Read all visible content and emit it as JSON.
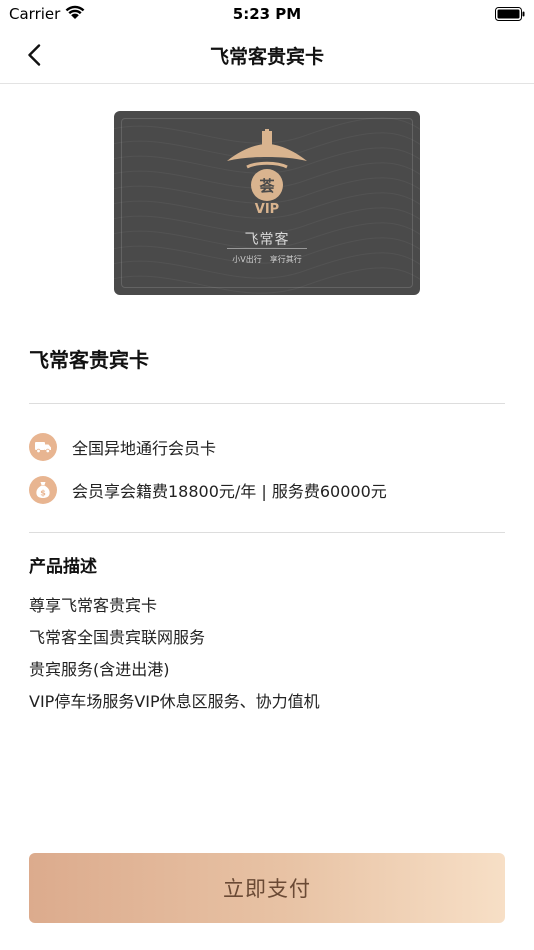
{
  "status_bar": {
    "carrier": "Carrier",
    "time": "5:23 PM"
  },
  "nav": {
    "title": "飞常客贵宾卡"
  },
  "card": {
    "badge": "VIP",
    "logo_glyph": "荟",
    "brand": "飞常客",
    "slogan": "小V出行　享行其行"
  },
  "product": {
    "title": "飞常客贵宾卡"
  },
  "features": [
    {
      "icon": "delivery-truck-icon",
      "text": "全国异地通行会员卡"
    },
    {
      "icon": "money-bag-icon",
      "text": "会员享会籍费18800元/年 | 服务费60000元"
    }
  ],
  "description": {
    "title": "产品描述",
    "lines": [
      "尊享飞常客贵宾卡",
      "飞常客全国贵宾联网服务",
      "贵宾服务(含进出港)",
      "VIP停车场服务VIP休息区服务、协力值机"
    ]
  },
  "pay_button": {
    "label": "立即支付"
  },
  "colors": {
    "accent": "#e8b591",
    "card_bg": "#4a4a4a",
    "gold": "#d9b48f",
    "button_start": "#dcab8d",
    "button_end": "#f7dfc6"
  }
}
